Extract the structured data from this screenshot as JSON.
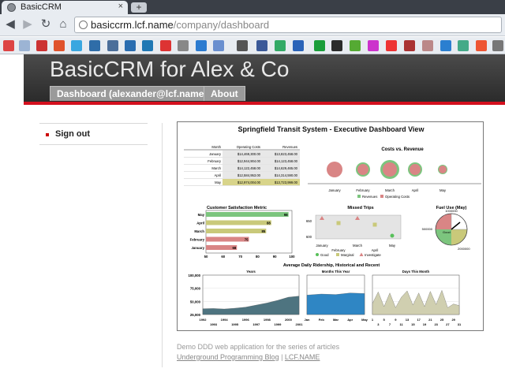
{
  "browser": {
    "tab_title": "BasicCRM",
    "tab_close": "×",
    "new_tab": "+",
    "url_host": "basiccrm.lcf.name",
    "url_path": "/company/dashboard"
  },
  "header": {
    "app_title": "BasicCRM for Alex & Co",
    "tabs": [
      {
        "label": "Dashboard (alexander@lcf.name)"
      },
      {
        "label": "About"
      }
    ]
  },
  "sidebar": {
    "items": [
      {
        "label": "Sign out"
      }
    ]
  },
  "dashboard": {
    "title": "Springfield Transit System - Executive Dashboard View",
    "table": {
      "headers": [
        "Month",
        "Operating Costs",
        "Revenues"
      ],
      "rows": [
        [
          "January",
          "$14,469,300.00",
          "$13,823,458.00"
        ],
        [
          "February",
          "$12,944,904.00",
          "$14,123,458.00"
        ],
        [
          "March",
          "$14,122,458.00",
          "$14,629,465.00"
        ],
        [
          "April",
          "$12,584,953.00",
          "$14,314,590.00"
        ],
        [
          "May",
          "$12,974,004.00",
          "$13,723,999.00"
        ]
      ]
    }
  },
  "chart_data": [
    {
      "type": "scatter",
      "title": "Costs vs. Revenue",
      "categories": [
        "January",
        "February",
        "March",
        "April",
        "May"
      ],
      "legend": [
        "Revenues",
        "Operating Costs"
      ],
      "colors": {
        "revenues": "#7cc57e",
        "costs": "#d98585"
      }
    },
    {
      "type": "bar",
      "title": "Customer Satisfaction Metric",
      "categories": [
        "May",
        "April",
        "March",
        "February",
        "January"
      ],
      "values": [
        98,
        88,
        85,
        75,
        68
      ],
      "colors": [
        "#7cc57e",
        "#c9c97a",
        "#c9c97a",
        "#d98585",
        "#d98585"
      ],
      "xticks": [
        "50",
        "60",
        "70",
        "80",
        "90",
        "100"
      ],
      "xlim": [
        50,
        100
      ]
    },
    {
      "type": "scatter",
      "title": "Missed Trips",
      "categories": [
        "January",
        "February",
        "March",
        "April",
        "May"
      ],
      "yticks": [
        "650",
        "600"
      ],
      "points": [
        {
          "x": "January",
          "y": 655,
          "status": "Investigate"
        },
        {
          "x": "February",
          "y": 640,
          "status": "Marginal"
        },
        {
          "x": "March",
          "y": 655,
          "status": "Investigate"
        },
        {
          "x": "April",
          "y": 635,
          "status": "Marginal"
        },
        {
          "x": "May",
          "y": 600,
          "status": "Good"
        }
      ],
      "legend": [
        "Good",
        "Marginal",
        "Investigate"
      ]
    },
    {
      "type": "pie",
      "title": "Fuel Use (May)",
      "labels": [
        "1000000",
        "500000",
        "2000000",
        "Good"
      ]
    },
    {
      "type": "area",
      "title": "Average Daily Ridership, Historical and Recent",
      "subcharts": [
        {
          "label": "Years",
          "x": [
            "1992",
            "1993",
            "1994",
            "1995",
            "1996",
            "1997",
            "1998",
            "1999",
            "2000",
            "2001"
          ],
          "values": [
            36000,
            36500,
            35500,
            37000,
            39000,
            43000,
            47000,
            52000,
            58000,
            60000
          ],
          "ylim": [
            25000,
            100000
          ],
          "yticks": [
            "100,000",
            "75,000",
            "50,000",
            "25,000"
          ]
        },
        {
          "label": "Months This Year",
          "x": [
            "Jan",
            "Feb",
            "Mar",
            "Apr",
            "May"
          ],
          "values": [
            62000,
            64000,
            63000,
            66000,
            65000
          ]
        },
        {
          "label": "Days This Month",
          "x": [
            "1",
            "3",
            "5",
            "7",
            "9",
            "11",
            "13",
            "15",
            "17",
            "19",
            "21",
            "23",
            "25",
            "27",
            "29",
            "31"
          ],
          "values": [
            46000,
            68000,
            40000,
            66000,
            38000,
            58000,
            70000,
            43000,
            66000,
            40000,
            69000,
            44000,
            71000,
            38000,
            45000,
            42000
          ]
        }
      ]
    }
  ],
  "footer": {
    "line1": "Demo DDD web application for the series of articles",
    "link1": "Underground Programming Blog",
    "separator": " | ",
    "link2": "LCF.NAME"
  }
}
